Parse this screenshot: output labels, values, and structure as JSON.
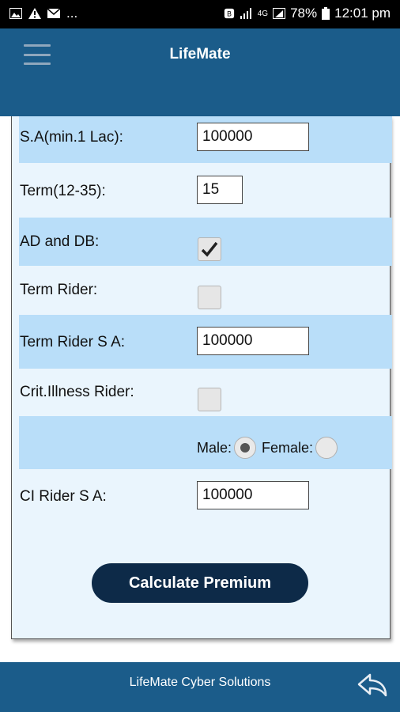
{
  "status_bar": {
    "left_icons": [
      "image-icon",
      "alert-icon",
      "mail-icon"
    ],
    "left_more": "...",
    "network_label": "4G",
    "battery": "78%",
    "time": "12:01 pm"
  },
  "app_bar": {
    "title": "LifeMate",
    "menu_icon": "hamburger-icon"
  },
  "form": {
    "sum_assured_label": "S.A(min.1 Lac):",
    "sum_assured_value": "100000",
    "term_label": "Term(12-35):",
    "term_value": "15",
    "ad_db_label": "AD and DB:",
    "ad_db_checked": true,
    "term_rider_label": "Term Rider:",
    "term_rider_checked": false,
    "term_rider_sa_label": "Term Rider S A:",
    "term_rider_sa_value": "100000",
    "crit_illness_label": "Crit.Illness Rider:",
    "crit_illness_checked": false,
    "gender_male_label": "Male:",
    "gender_female_label": "Female:",
    "gender_selected": "Male",
    "ci_rider_sa_label": "CI Rider S A:",
    "ci_rider_sa_value": "100000",
    "calculate_button": "Calculate Premium"
  },
  "footer": {
    "text": "LifeMate Cyber Solutions",
    "back_icon": "back-arrow-icon"
  },
  "colors": {
    "app_bar": "#1b5c8a",
    "row_shade": "#b9def9",
    "card_bg": "#eaf5fd",
    "button": "#0d2a48"
  }
}
